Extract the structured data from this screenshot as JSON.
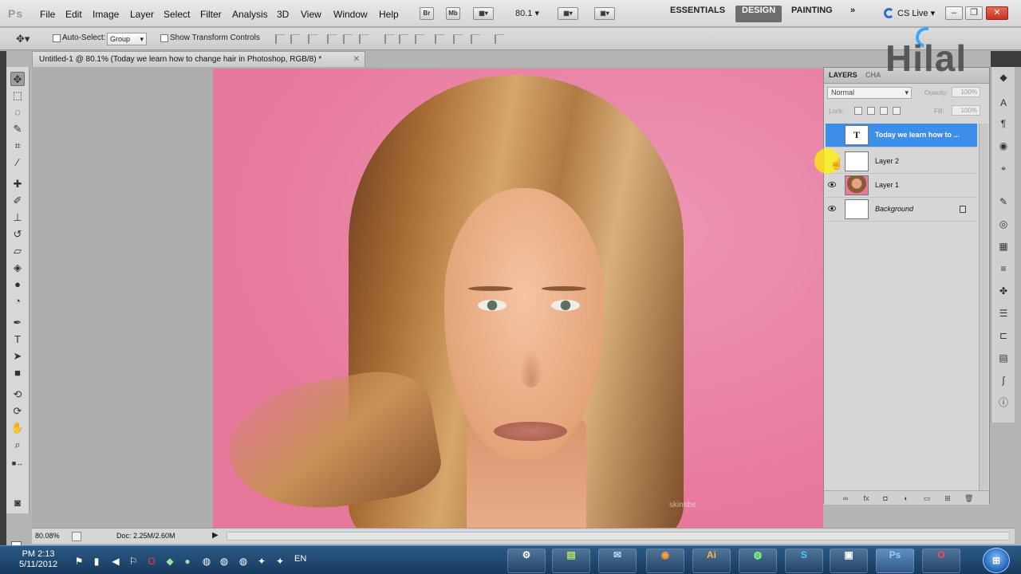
{
  "app": {
    "logo_text": "Ps"
  },
  "menu": [
    "File",
    "Edit",
    "Image",
    "Layer",
    "Select",
    "Filter",
    "Analysis",
    "3D",
    "View",
    "Window",
    "Help"
  ],
  "menubar": {
    "bridge_label": "Br",
    "minibridge_label": "Mb",
    "zoom_value": "80.1",
    "workspaces": [
      "ESSENTIALS",
      "DESIGN",
      "PAINTING"
    ],
    "active_workspace": "DESIGN",
    "more_label": "»",
    "cslive_label": "CS Live"
  },
  "options": {
    "auto_select_label": "Auto-Select:",
    "auto_select_value": "Group",
    "show_transform_label": "Show Transform Controls"
  },
  "document": {
    "tab_title": "Untitled-1 @ 80.1% (Today we learn  how to change hair in Photoshop, RGB/8) *",
    "close_glyph": "✕",
    "image_watermark": "skinsbe"
  },
  "layers_panel": {
    "tabs": [
      "LAYERS",
      "CHA"
    ],
    "blend_mode": "Normal",
    "opacity_label": "Opacity:",
    "opacity_value": "100%",
    "lock_label": "Lock:",
    "fill_label": "Fill:",
    "fill_value": "100%",
    "layers": [
      {
        "name": "Today we learn  how to ...",
        "type": "text",
        "thumb": "T",
        "visible": false,
        "selected": true
      },
      {
        "name": "Layer 2",
        "type": "blank",
        "thumb": "",
        "visible": false,
        "selected": false
      },
      {
        "name": "Layer 1",
        "type": "photo",
        "thumb": "",
        "visible": true,
        "selected": false
      },
      {
        "name": "Background",
        "type": "background",
        "thumb": "",
        "visible": true,
        "selected": false,
        "locked": true
      }
    ]
  },
  "watermark": {
    "text": "Hilal"
  },
  "status": {
    "zoom": "80.08%",
    "doc_info": "Doc: 2.25M/2.60M"
  },
  "taskbar": {
    "time": "PM 2:13",
    "date": "5/11/2012",
    "language": "EN",
    "apps": [
      "Ai",
      "Ps"
    ]
  },
  "colors": {
    "selection_blue": "#3d8ee8",
    "canvas_pink": "#e7789c",
    "taskbar_blue": "#1f4a73"
  }
}
